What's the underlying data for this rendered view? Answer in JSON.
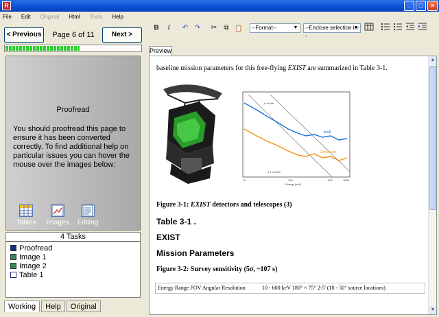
{
  "titlebar": {
    "app_icon": "R",
    "minimize": "_",
    "maximize": "□",
    "close": "×"
  },
  "menu": [
    {
      "label": "File",
      "enabled": true
    },
    {
      "label": "Edit",
      "enabled": true
    },
    {
      "label": "Original",
      "enabled": false
    },
    {
      "label": "Html",
      "enabled": true
    },
    {
      "label": "Tools",
      "enabled": false
    },
    {
      "label": "Help",
      "enabled": true
    }
  ],
  "nav": {
    "previous": "< Previous",
    "next": "Next >",
    "page": "Page 6 of 11",
    "progress": 0.55
  },
  "info": {
    "title": "Proofread",
    "text": "You should proofread this page to ensure it  has been converted correctly. To find additional help on particular issues you can  hover the mouse over the images below:",
    "icons": [
      {
        "label": "Tables",
        "icon": "table-icon"
      },
      {
        "label": "Images",
        "icon": "image-icon"
      },
      {
        "label": "Editing",
        "icon": "document-icon"
      }
    ]
  },
  "tasks": {
    "header": "4 Tasks",
    "items": [
      {
        "label": "Proofread",
        "icon": "proofread-icon",
        "color": "#1a2c8c"
      },
      {
        "label": "Image 1",
        "icon": "image-icon",
        "color": "#2e8b57"
      },
      {
        "label": "Image 2",
        "icon": "image-icon",
        "color": "#2e8b57"
      },
      {
        "label": "Table 1",
        "icon": "table-icon",
        "color": "#1a2c8c"
      }
    ]
  },
  "bottom_tabs": [
    "Working",
    "Help",
    "Original"
  ],
  "toolbar": {
    "bold": "B",
    "italic": "I",
    "undo": "↶",
    "redo": "↷",
    "cut": "✂",
    "copy": "⧉",
    "paste": "📋",
    "format_select": "--Format--",
    "enclose_select": "--Enclose selection in--"
  },
  "preview": {
    "tab": "Preview",
    "intro_pre": "baseline mission parameters for this free-flying ",
    "intro_em": "EXIST",
    "intro_post": " are summarized in Table 3-1.",
    "fig1_pre": "Figure 3-1: ",
    "fig1_em": "EXIST",
    "fig1_post": " detectors and telescopes (3)",
    "heading_table": "Table 3-1 .",
    "heading_exist": "EXIST",
    "heading_mission": "Mission Parameters",
    "fig2": "Figure 3-2: Survey sensitivity (5σ, ~107 s)",
    "table_row": [
      "Energy Range FOV Angular Resolution",
      "10 - 600 keV 180° × 75° 2-5' (10 - 50\" source locations)"
    ]
  },
  "plot_labels": {
    "line1": "lineE",
    "line2": "Continuum",
    "line3": "1 mCrab",
    "line4": "0.1 mCrab",
    "xlabel": "Energy (keV)",
    "x_ticks": [
      "10",
      "100",
      "500",
      "1000"
    ]
  },
  "colors": {
    "progress": "#2fd22f",
    "accent": "#0a4fd6",
    "series_blue": "#1a6fe0",
    "series_orange": "#f0900a"
  }
}
